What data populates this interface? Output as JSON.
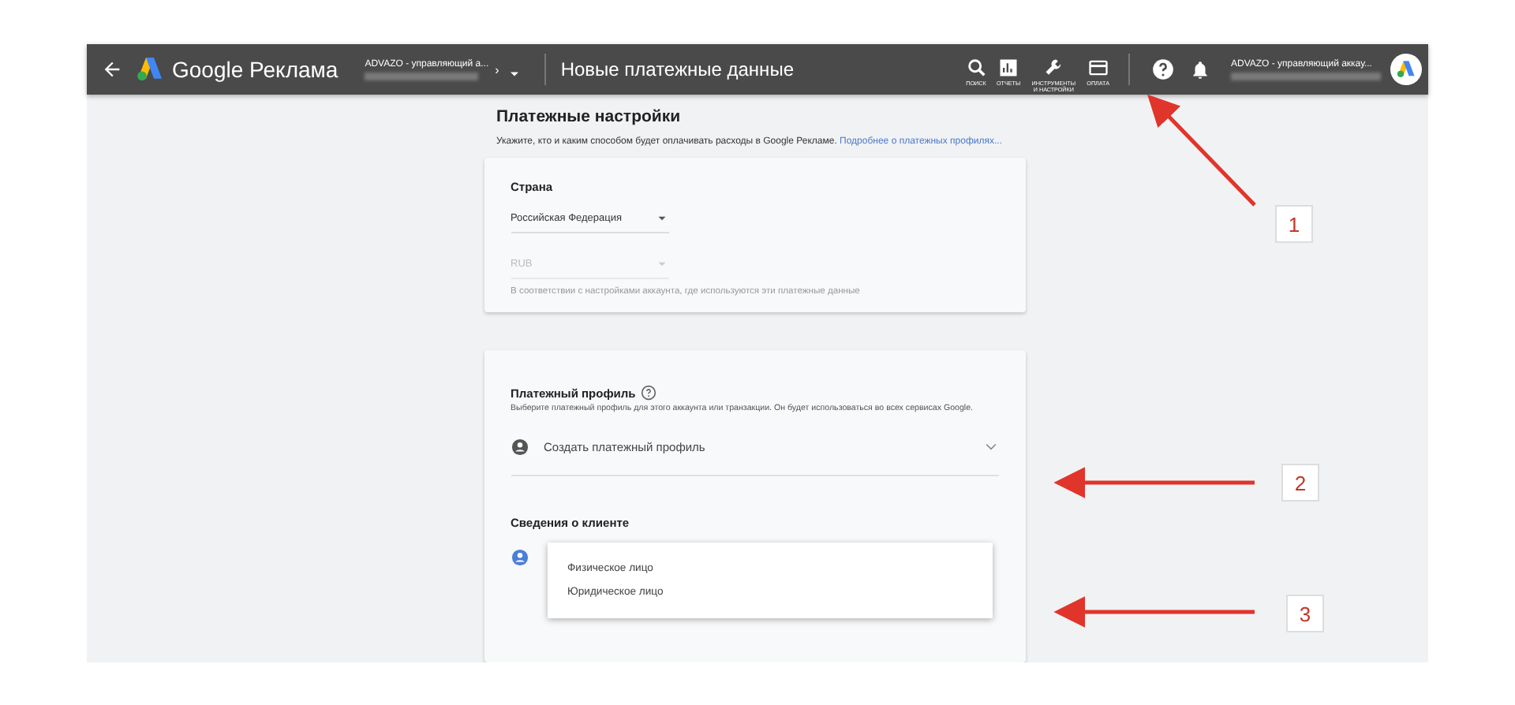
{
  "header": {
    "logo_text": "Google Реклама",
    "account": "ADVAZO - управляющий а...",
    "account_arrow": "›",
    "page_title": "Новые платежные данные",
    "nav_items": [
      {
        "kind": "search",
        "label": "ПОИСК"
      },
      {
        "kind": "reports",
        "label": "ОТЧЕТЫ"
      },
      {
        "kind": "tools",
        "label": "ИНСТРУМЕНТЫ И НАСТРОЙКИ"
      },
      {
        "kind": "billing",
        "label": "ОПЛАТА"
      }
    ],
    "account_right": "ADVAZO - управляющий аккау..."
  },
  "main": {
    "title": "Платежные настройки",
    "intro": "Укажите, кто и каким способом будет оплачивать расходы в Google Рекламе.",
    "intro_link": "Подробнее о платежных профилях...",
    "country_card": {
      "heading": "Страна",
      "country": "Российская Федерация",
      "currency": "RUB",
      "currency_disabled": true,
      "note": "В соответствии с настройками аккаунта, где используются эти платежные данные"
    },
    "profile_card": {
      "heading": "Платежный профиль",
      "description": "Выберите платежный профиль для этого аккаунта или транзакции. Он будет использоваться во всех сервисах Google.",
      "profile_select": "Создать платежный профиль",
      "client_heading": "Сведения о клиенте",
      "client_options": [
        {
          "label": "Физическое лицо"
        },
        {
          "label": "Юридическое лицо"
        }
      ]
    }
  },
  "annotations": [
    {
      "label": "1"
    },
    {
      "label": "2"
    },
    {
      "label": "3"
    }
  ]
}
